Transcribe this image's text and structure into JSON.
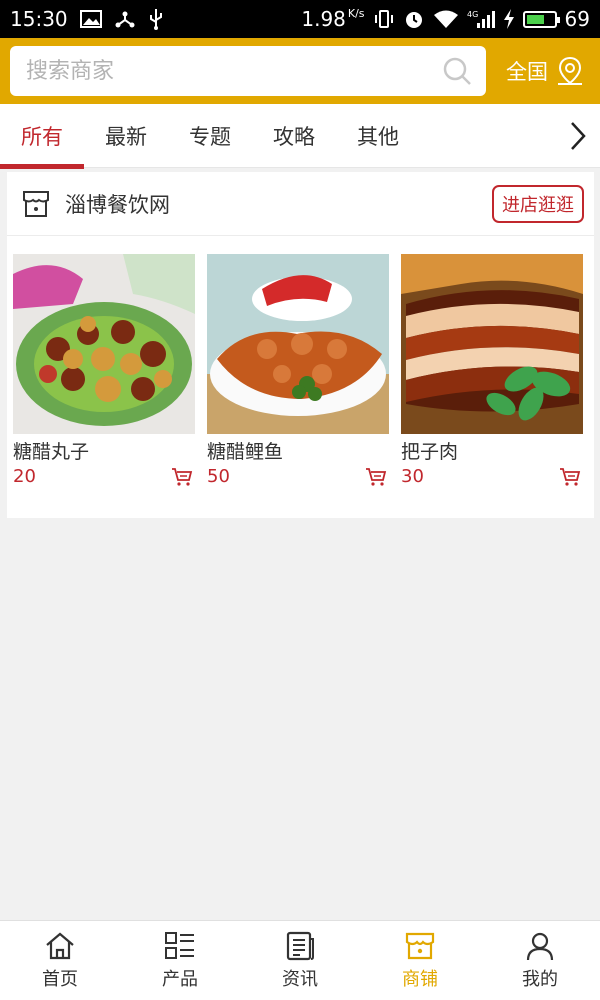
{
  "status_bar": {
    "time": "15:30",
    "speed": "1.98",
    "speed_unit": "K/s",
    "network": "4G",
    "battery": "69",
    "battery_level": 0.69
  },
  "header": {
    "search_placeholder": "搜索商家",
    "region_label": "全国"
  },
  "tabs": [
    {
      "label": "所有",
      "active": true
    },
    {
      "label": "最新"
    },
    {
      "label": "专题"
    },
    {
      "label": "攻略"
    },
    {
      "label": "其他"
    }
  ],
  "shop": {
    "name": "淄博餐饮网",
    "visit_label": "进店逛逛",
    "products": [
      {
        "name": "糖醋丸子",
        "price": "20"
      },
      {
        "name": "糖醋鲤鱼",
        "price": "50"
      },
      {
        "name": "把子肉",
        "price": "30"
      }
    ]
  },
  "bottom_nav": [
    {
      "label": "首页",
      "icon": "home-icon"
    },
    {
      "label": "产品",
      "icon": "list-icon"
    },
    {
      "label": "资讯",
      "icon": "news-icon"
    },
    {
      "label": "商铺",
      "icon": "shop-icon",
      "active": true
    },
    {
      "label": "我的",
      "icon": "user-icon"
    }
  ],
  "colors": {
    "brand": "#e1a800",
    "accent": "#c1272d"
  }
}
